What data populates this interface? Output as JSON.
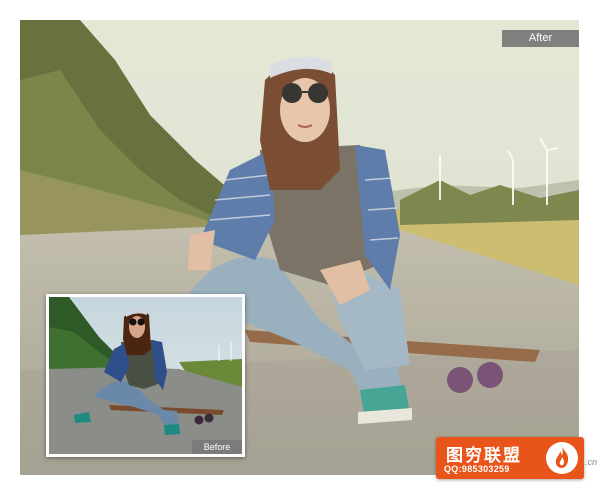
{
  "labels": {
    "after": "After",
    "before": "Before"
  },
  "watermark": {
    "title": "图穷联盟",
    "contact": "QQ:985303259",
    "suffix": ".cn",
    "color": "#e8541a"
  },
  "colors": {
    "sky": "#dfe6d6",
    "road": "#a9a79d",
    "foliage": "#5d6a33",
    "shirt": "#4a6fa8",
    "jeans": "#8fa9bf",
    "shoes": "#2f9c8f",
    "board": "#8a5a3a"
  },
  "icons": {
    "watermark_logo": "flame-icon"
  }
}
